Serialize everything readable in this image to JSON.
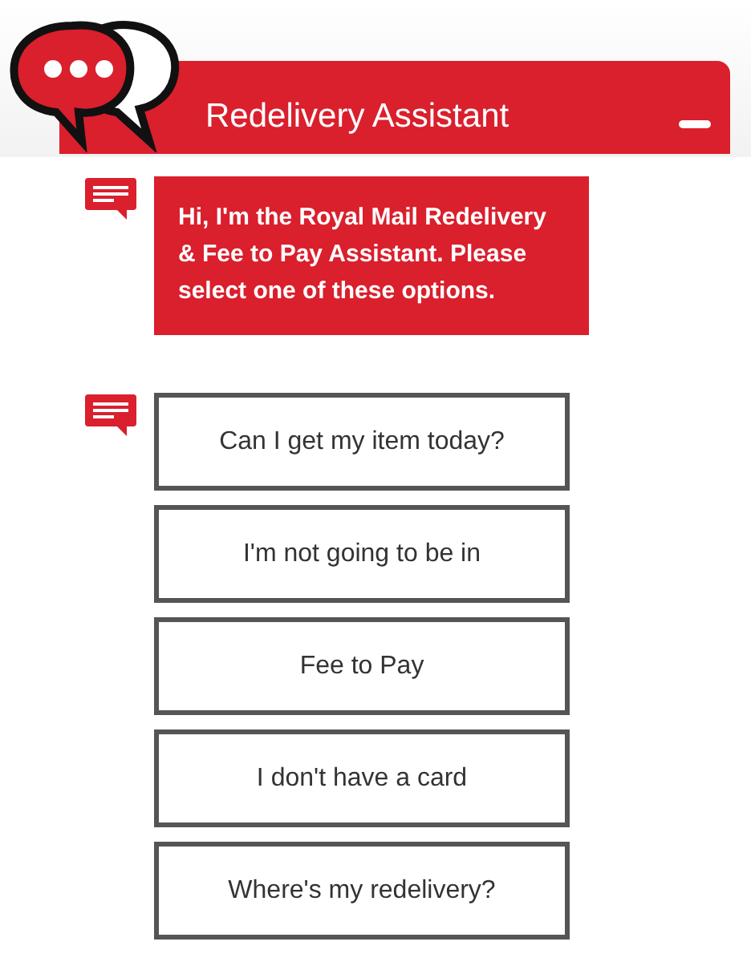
{
  "header": {
    "title": "Redelivery Assistant"
  },
  "messages": [
    {
      "kind": "text",
      "text": "Hi, I'm the Royal Mail Redelivery & Fee to Pay Assistant. Please select one of these options."
    },
    {
      "kind": "options",
      "options": [
        "Can I get my item today?",
        "I'm not going to be in",
        "Fee to Pay",
        "I don't have a card",
        "Where's my redelivery?"
      ]
    }
  ]
}
